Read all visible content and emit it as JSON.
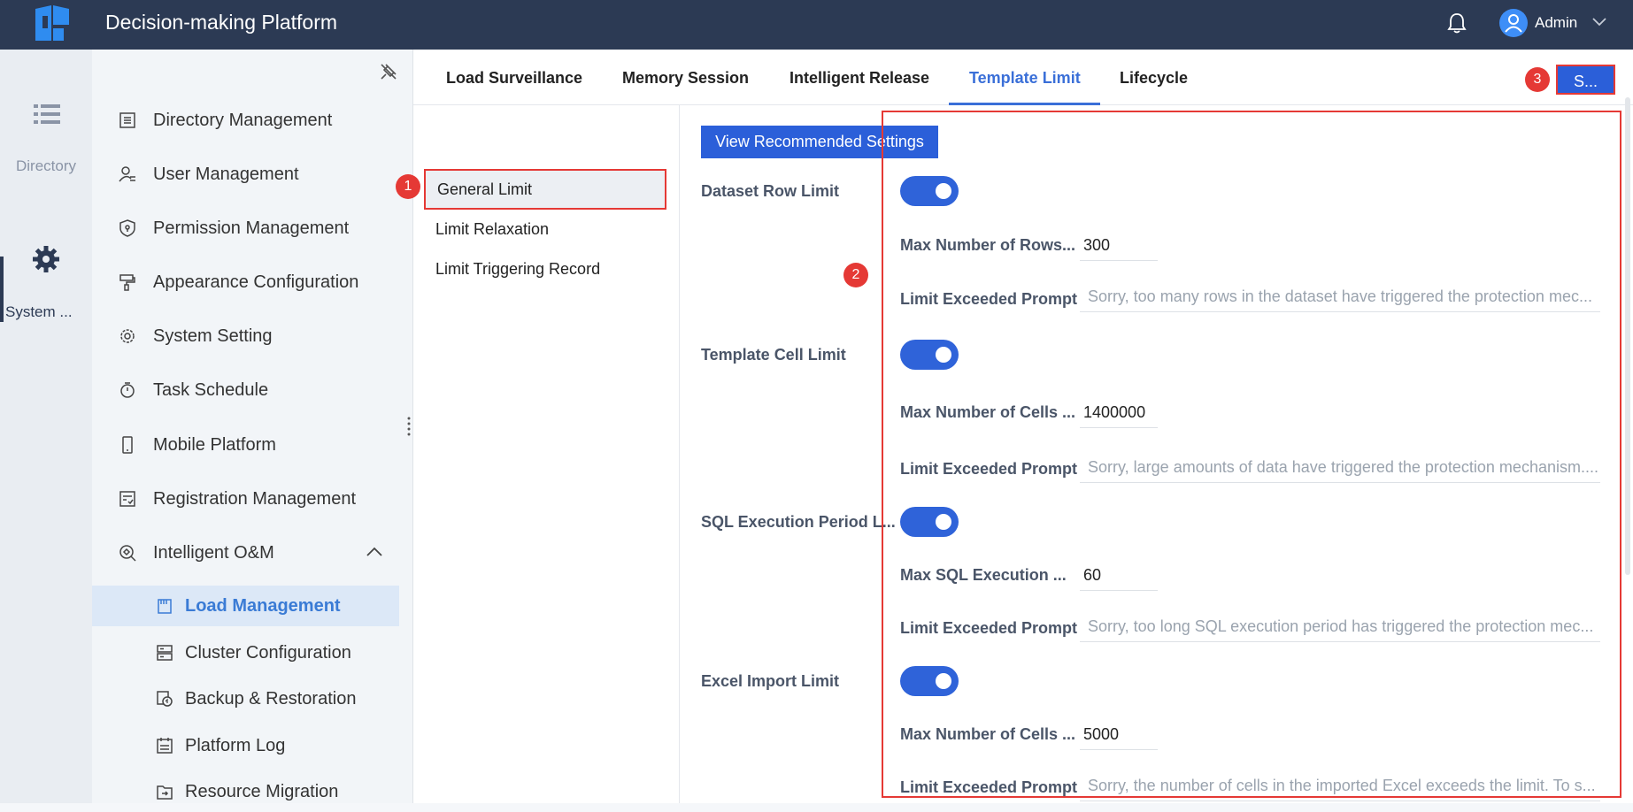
{
  "header": {
    "title": "Decision-making Platform",
    "user": "Admin",
    "brand_color": "#2c3a54"
  },
  "rail": {
    "directory_label": "Directory",
    "system_label": "System ..."
  },
  "sidebar": {
    "items": [
      {
        "label": "Directory Management",
        "icon": "directory-icon"
      },
      {
        "label": "User Management",
        "icon": "user-icon"
      },
      {
        "label": "Permission Management",
        "icon": "shield-icon"
      },
      {
        "label": "Appearance Configuration",
        "icon": "paint-roller-icon"
      },
      {
        "label": "System Setting",
        "icon": "gear-icon"
      },
      {
        "label": "Task Schedule",
        "icon": "timer-icon"
      },
      {
        "label": "Mobile Platform",
        "icon": "mobile-icon"
      },
      {
        "label": "Registration Management",
        "icon": "registration-icon"
      },
      {
        "label": "Intelligent O&M",
        "icon": "om-icon"
      }
    ],
    "sub_items": [
      {
        "label": "Load Management",
        "icon": "load-icon",
        "active": true
      },
      {
        "label": "Cluster Configuration",
        "icon": "cluster-icon"
      },
      {
        "label": "Backup & Restoration",
        "icon": "backup-icon"
      },
      {
        "label": "Platform Log",
        "icon": "log-icon"
      },
      {
        "label": "Resource Migration",
        "icon": "migration-icon"
      }
    ]
  },
  "tabs": [
    {
      "label": "Load Surveillance"
    },
    {
      "label": "Memory Session"
    },
    {
      "label": "Intelligent Release"
    },
    {
      "label": "Template Limit",
      "active": true
    },
    {
      "label": "Lifecycle"
    }
  ],
  "save_button": "S...",
  "subnav": [
    {
      "label": "General Limit",
      "active": true
    },
    {
      "label": "Limit Relaxation"
    },
    {
      "label": "Limit Triggering Record"
    }
  ],
  "content": {
    "recommended_button": "View Recommended Settings",
    "sections": [
      {
        "title": "Dataset Row Limit",
        "enabled": true,
        "max_label": "Max Number of Rows...",
        "max_value": "300",
        "prompt_label": "Limit Exceeded Prompt",
        "prompt_value": "Sorry, too many rows in the dataset have triggered the protection mec..."
      },
      {
        "title": "Template Cell Limit",
        "enabled": true,
        "max_label": "Max Number of Cells ...",
        "max_value": "1400000",
        "prompt_label": "Limit Exceeded Prompt",
        "prompt_value": "Sorry, large amounts of data have triggered the protection mechanism...."
      },
      {
        "title": "SQL Execution Period L...",
        "enabled": true,
        "max_label": "Max SQL Execution ...",
        "max_value": "60",
        "prompt_label": "Limit Exceeded Prompt",
        "prompt_value": "Sorry, too long SQL execution period has triggered the protection mec..."
      },
      {
        "title": "Excel Import Limit",
        "enabled": true,
        "max_label": "Max Number of Cells ...",
        "max_value": "5000",
        "prompt_label": "Limit Exceeded Prompt",
        "prompt_value": "Sorry, the number of cells in the imported Excel exceeds the limit. To s..."
      }
    ]
  },
  "annotations": [
    "1",
    "2",
    "3"
  ],
  "colors": {
    "accent": "#2b5fd9",
    "annotation": "#e53935",
    "active_tab": "#3a6fd8"
  }
}
